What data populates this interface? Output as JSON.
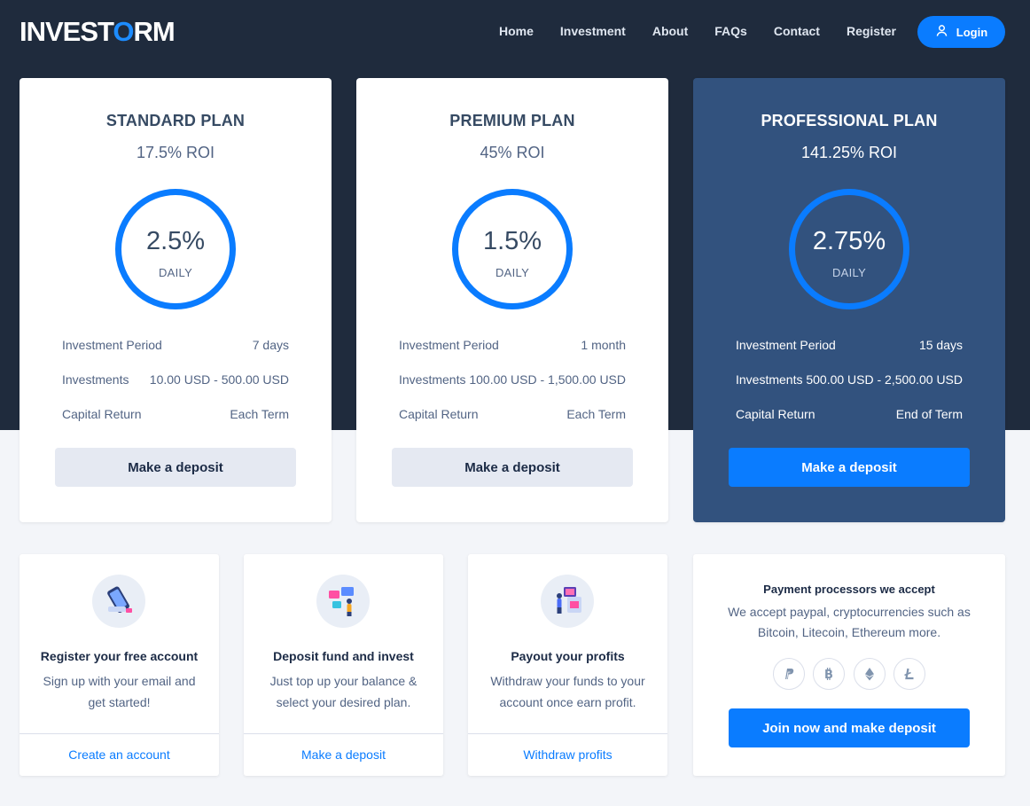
{
  "brand": {
    "logo_part1": "INVEST",
    "logo_accent": "O",
    "logo_part2": "RM"
  },
  "nav": {
    "items": [
      "Home",
      "Investment",
      "About",
      "FAQs",
      "Contact",
      "Register"
    ],
    "login_label": "Login"
  },
  "plans": [
    {
      "name": "STANDARD PLAN",
      "roi": "17.5% ROI",
      "rate": "2.5%",
      "rate_label": "DAILY",
      "rows": [
        {
          "label": "Investment Period",
          "value": "7 days"
        },
        {
          "label": "Investments",
          "value": "10.00 USD - 500.00 USD"
        },
        {
          "label": "Capital Return",
          "value": "Each Term"
        }
      ],
      "button": "Make a deposit"
    },
    {
      "name": "PREMIUM PLAN",
      "roi": "45% ROI",
      "rate": "1.5%",
      "rate_label": "DAILY",
      "rows": [
        {
          "label": "Investment Period",
          "value": "1 month"
        },
        {
          "label": "Investments",
          "value": "100.00 USD - 1,500.00 USD"
        },
        {
          "label": "Capital Return",
          "value": "Each Term"
        }
      ],
      "button": "Make a deposit"
    },
    {
      "name": "PROFESSIONAL PLAN",
      "roi": "141.25% ROI",
      "rate": "2.75%",
      "rate_label": "DAILY",
      "rows": [
        {
          "label": "Investment Period",
          "value": "15 days"
        },
        {
          "label": "Investments",
          "value": "500.00 USD - 2,500.00 USD"
        },
        {
          "label": "Capital Return",
          "value": "End of Term"
        }
      ],
      "button": "Make a deposit"
    }
  ],
  "steps": [
    {
      "icon": "phone-illustration-icon",
      "title": "Register your free account",
      "text": "Sign up with your email and get started!",
      "link": "Create an account"
    },
    {
      "icon": "invest-illustration-icon",
      "title": "Deposit fund and invest",
      "text": "Just top up your balance & select your desired plan.",
      "link": "Make a deposit"
    },
    {
      "icon": "atm-illustration-icon",
      "title": "Payout your profits",
      "text": "Withdraw your funds to your account once earn profit.",
      "link": "Withdraw profits"
    }
  ],
  "payment": {
    "title": "Payment processors we accept",
    "text": "We accept paypal, cryptocurrencies such as Bitcoin, Litecoin, Ethereum more.",
    "icons": [
      "paypal-icon",
      "bitcoin-icon",
      "ethereum-icon",
      "litecoin-icon"
    ],
    "button": "Join now and make deposit"
  },
  "colors": {
    "header_bg": "#1f2b3d",
    "accent": "#0a7cff",
    "featured_card": "#32527e",
    "page_bg": "#f3f5f9"
  }
}
